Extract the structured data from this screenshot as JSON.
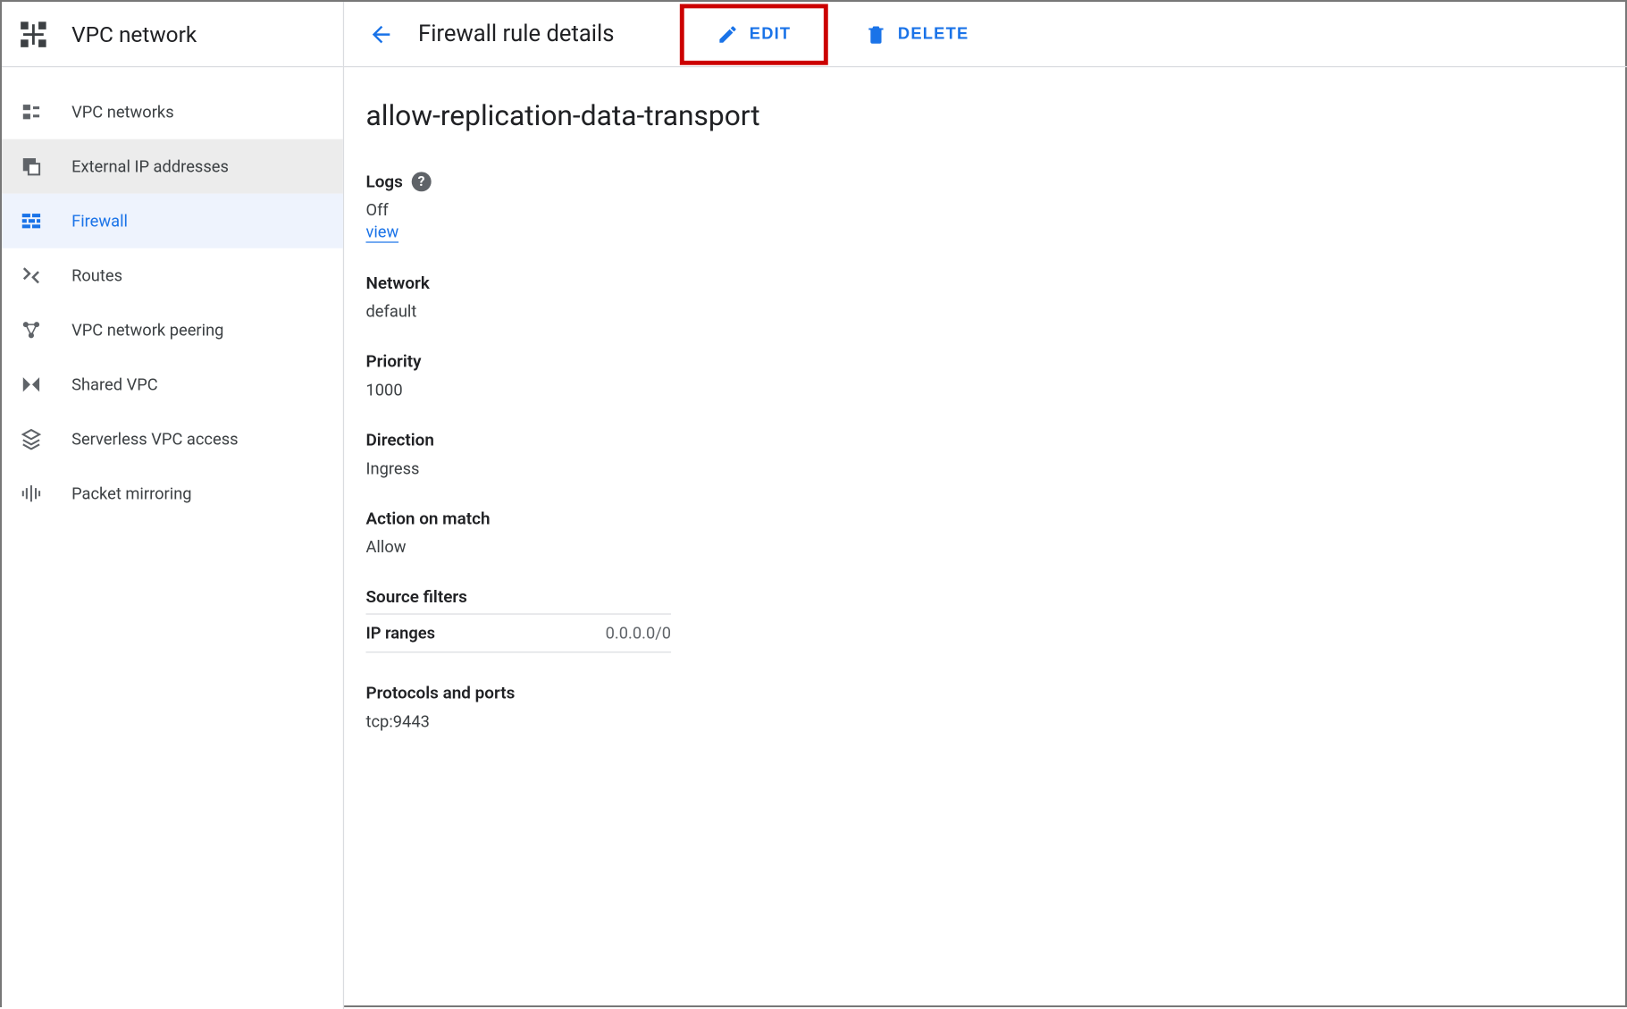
{
  "sidebar": {
    "title": "VPC network",
    "items": [
      {
        "label": "VPC networks"
      },
      {
        "label": "External IP addresses"
      },
      {
        "label": "Firewall"
      },
      {
        "label": "Routes"
      },
      {
        "label": "VPC network peering"
      },
      {
        "label": "Shared VPC"
      },
      {
        "label": "Serverless VPC access"
      },
      {
        "label": "Packet mirroring"
      }
    ]
  },
  "topbar": {
    "title": "Firewall rule details",
    "edit_label": "EDIT",
    "delete_label": "DELETE"
  },
  "rule": {
    "name": "allow-replication-data-transport",
    "logs_label": "Logs",
    "logs_value": "Off",
    "logs_link": "view",
    "network_label": "Network",
    "network_value": "default",
    "priority_label": "Priority",
    "priority_value": "1000",
    "direction_label": "Direction",
    "direction_value": "Ingress",
    "action_label": "Action on match",
    "action_value": "Allow",
    "source_filters_label": "Source filters",
    "ip_ranges_label": "IP ranges",
    "ip_ranges_value": "0.0.0.0/0",
    "protocols_label": "Protocols and ports",
    "protocols_value": "tcp:9443"
  },
  "help_symbol": "?"
}
